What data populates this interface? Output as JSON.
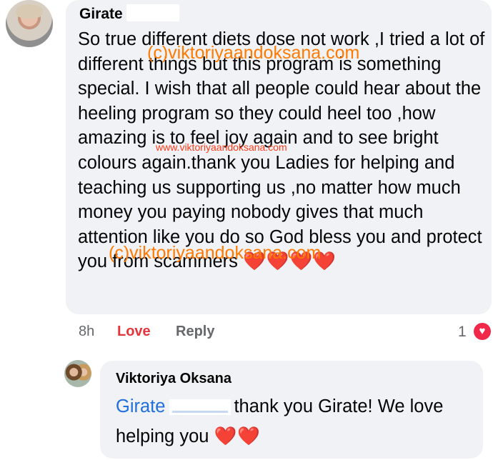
{
  "comment": {
    "author": "Girate",
    "text": "So true different diets dose not work ,I tried a lot of different things but this program is something special. I wish that all people could hear about the heeling program so they could heel too ,how amazing is to feel joy again and to see bright colours again.thank you Ladies for helping and teaching us supporting us ,no matter how much money you paying nobody gives that much attention like you do so God bless you and protect you from scammers",
    "emoji": "❤️❤️❤️❤️",
    "time": "8h",
    "love_label": "Love",
    "reply_label": "Reply",
    "reaction_count": "1",
    "reaction_icon": "heart-icon"
  },
  "reply": {
    "author": "Viktoriya Oksana",
    "mention": "Girate",
    "text": "thank you Girate! We love helping you",
    "emoji": "❤️❤️"
  },
  "watermarks": {
    "top": "(c)viktoriyaandoksana.com",
    "middle": "www.viktoriyaandoksana.com",
    "bottom": "(c)viktoriyaandoksana.com"
  },
  "colors": {
    "bubble": "#f0f2f5",
    "love_active": "#e4343c",
    "mention": "#216fdb",
    "watermark": "#ff7a00"
  }
}
